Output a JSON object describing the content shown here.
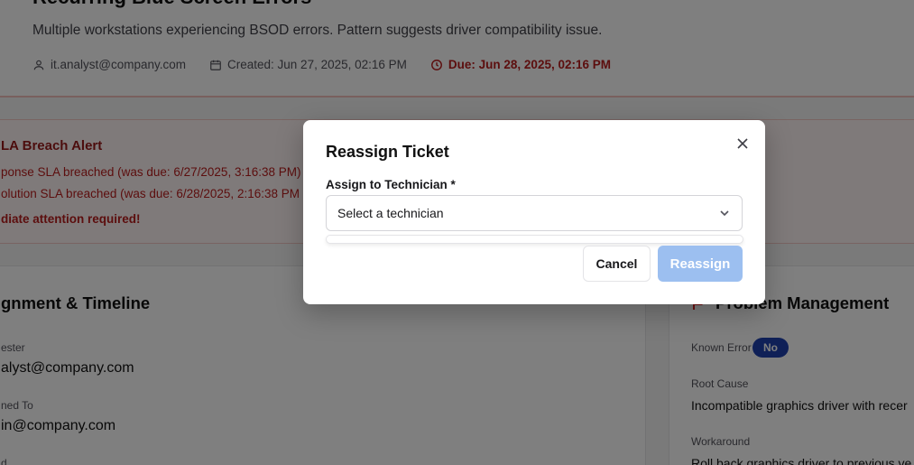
{
  "ticket": {
    "title": "Recurring Blue Screen Errors",
    "description": "Multiple workstations experiencing BSOD errors. Pattern suggests driver compatibility issue.",
    "requester_email": "it.analyst@company.com",
    "created": "Created: Jun 27, 2025, 02:16 PM",
    "due": "Due: Jun 28, 2025, 02:16 PM"
  },
  "sla_alert": {
    "title": "LA Breach Alert",
    "response_line": "ponse SLA breached (was due: 6/27/2025, 3:16:38 PM)",
    "resolution_line": "olution SLA breached (was due: 6/28/2025, 2:16:38 PM",
    "attention": "diate attention required!"
  },
  "assignment": {
    "section_title": "gnment & Timeline",
    "requester_label": "ester",
    "requester_value": "alyst@company.com",
    "assigned_label": "ned To",
    "assigned_value": "in@company.com",
    "next_label": "d"
  },
  "problem": {
    "section_title": "Problem Management",
    "known_error_label": "Known Error",
    "known_error_value": "No",
    "root_cause_label": "Root Cause",
    "root_cause_value": "Incompatible graphics driver with recer",
    "workaround_label": "Workaround",
    "workaround_value": "Roll back graphics driver to previous ve"
  },
  "modal": {
    "title": "Reassign Ticket",
    "field_label": "Assign to Technician *",
    "select_placeholder": "Select a technician",
    "cancel_label": "Cancel",
    "reassign_label": "Reassign"
  },
  "icons": {
    "user": "user-icon",
    "calendar": "calendar-icon",
    "clock": "clock-icon",
    "close": "close-icon",
    "chevron": "chevron-down-icon",
    "problem": "problem-icon"
  },
  "colors": {
    "danger": "#b91c1c",
    "badge": "#1e40af",
    "primary_disabled": "#9cbff0"
  }
}
